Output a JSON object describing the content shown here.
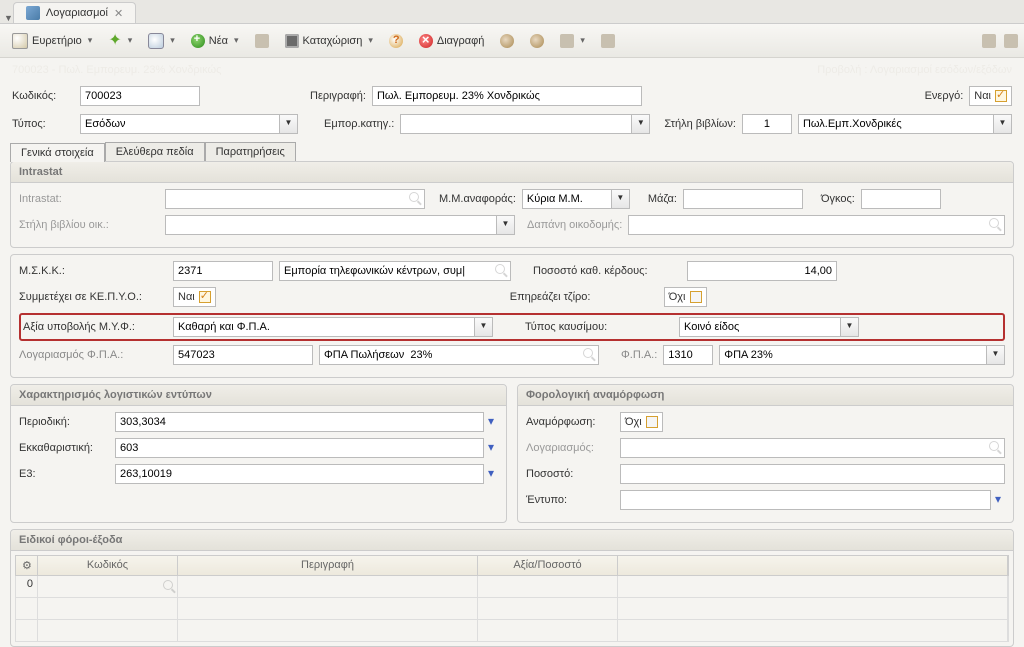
{
  "tab_title": "Λογαριασμοί",
  "toolbar": {
    "index": "Ευρετήριο",
    "new": "Νέα",
    "save": "Καταχώριση",
    "delete": "Διαγραφή"
  },
  "breadcrumb": {
    "left": "700023 - Πωλ. Εμπορευμ. 23% Χονδρικώς",
    "right": "Προβολή : Λογαριασμοί εσόδων/εξόδων"
  },
  "labels": {
    "code": "Κωδικός:",
    "descr": "Περιγραφή:",
    "active": "Ενεργό:",
    "type": "Τύπος:",
    "commcat": "Εμπορ.κατηγ.:",
    "bookcol": "Στήλη βιβλίων:",
    "nai": "Ναι",
    "oxi": "Όχι"
  },
  "fields": {
    "code": "700023",
    "descr": "Πωλ. Εμπορευμ. 23% Χονδρικώς",
    "type": "Εσόδων",
    "commcat": "",
    "bookcol_num": "1",
    "bookcol_txt": "Πωλ.Εμπ.Χονδρικές"
  },
  "inner_tabs": [
    "Γενικά στοιχεία",
    "Ελεύθερα πεδία",
    "Παρατηρήσεις"
  ],
  "intrastat": {
    "title": "Intrastat",
    "l_intrastat": "Intrastat:",
    "l_mm": "Μ.Μ.αναφοράς:",
    "v_mm": "Κύρια Μ.Μ.",
    "l_mass": "Μάζα:",
    "l_vol": "Όγκος:",
    "l_bookcoloik": "Στήλη βιβλίου οικ.:",
    "l_dapani": "Δαπάνη οικοδομής:"
  },
  "sec2": {
    "l_mskk": "Μ.Σ.Κ.Κ.:",
    "v_mskk_num": "2371",
    "v_mskk_txt": "Εμπορία τηλεφωνικών κέντρων, συμ|",
    "l_pososto": "Ποσοστό καθ. κέρδους:",
    "v_pososto": "14,00",
    "l_kepyo": "Συμμετέχει σε ΚΕ.Π.Υ.Ο.:",
    "v_kepyo": "Ναι",
    "l_tziro": "Επηρεάζει τζίρο:",
    "v_tziro": "Όχι",
    "l_myf": "Αξία υποβολής Μ.Υ.Φ.:",
    "v_myf": "Καθαρή και Φ.Π.Α.",
    "l_fuel": "Τύπος καυσίμου:",
    "v_fuel": "Κοινό είδος",
    "l_fpaacc": "Λογαριασμός Φ.Π.Α.:",
    "v_fpaacc_num": "547023",
    "v_fpaacc_txt": "ΦΠΑ Πωλήσεων  23%",
    "l_fpa": "Φ.Π.Α.:",
    "v_fpa_num": "1310",
    "v_fpa_txt": "ΦΠΑ 23%"
  },
  "panel3a": {
    "title": "Χαρακτηρισμός λογιστικών εντύπων",
    "l_period": "Περιοδική:",
    "v_period": "303,3034",
    "l_ekkath": "Εκκαθαριστική:",
    "v_ekkath": "603",
    "l_e3": "Ε3:",
    "v_e3": "263,10019"
  },
  "panel3b": {
    "title": "Φορολογική αναμόρφωση",
    "l_anam": "Αναμόρφωση:",
    "v_anam": "Όχι",
    "l_log": "Λογαριασμός:",
    "l_pos": "Ποσοστό:",
    "l_ent": "Έντυπο:"
  },
  "panel4": {
    "title": "Ειδικοί φόροι-έξοδα",
    "cols": [
      "Κωδικός",
      "Περιγραφή",
      "Αξία/Ποσοστό"
    ],
    "row0": "0"
  }
}
